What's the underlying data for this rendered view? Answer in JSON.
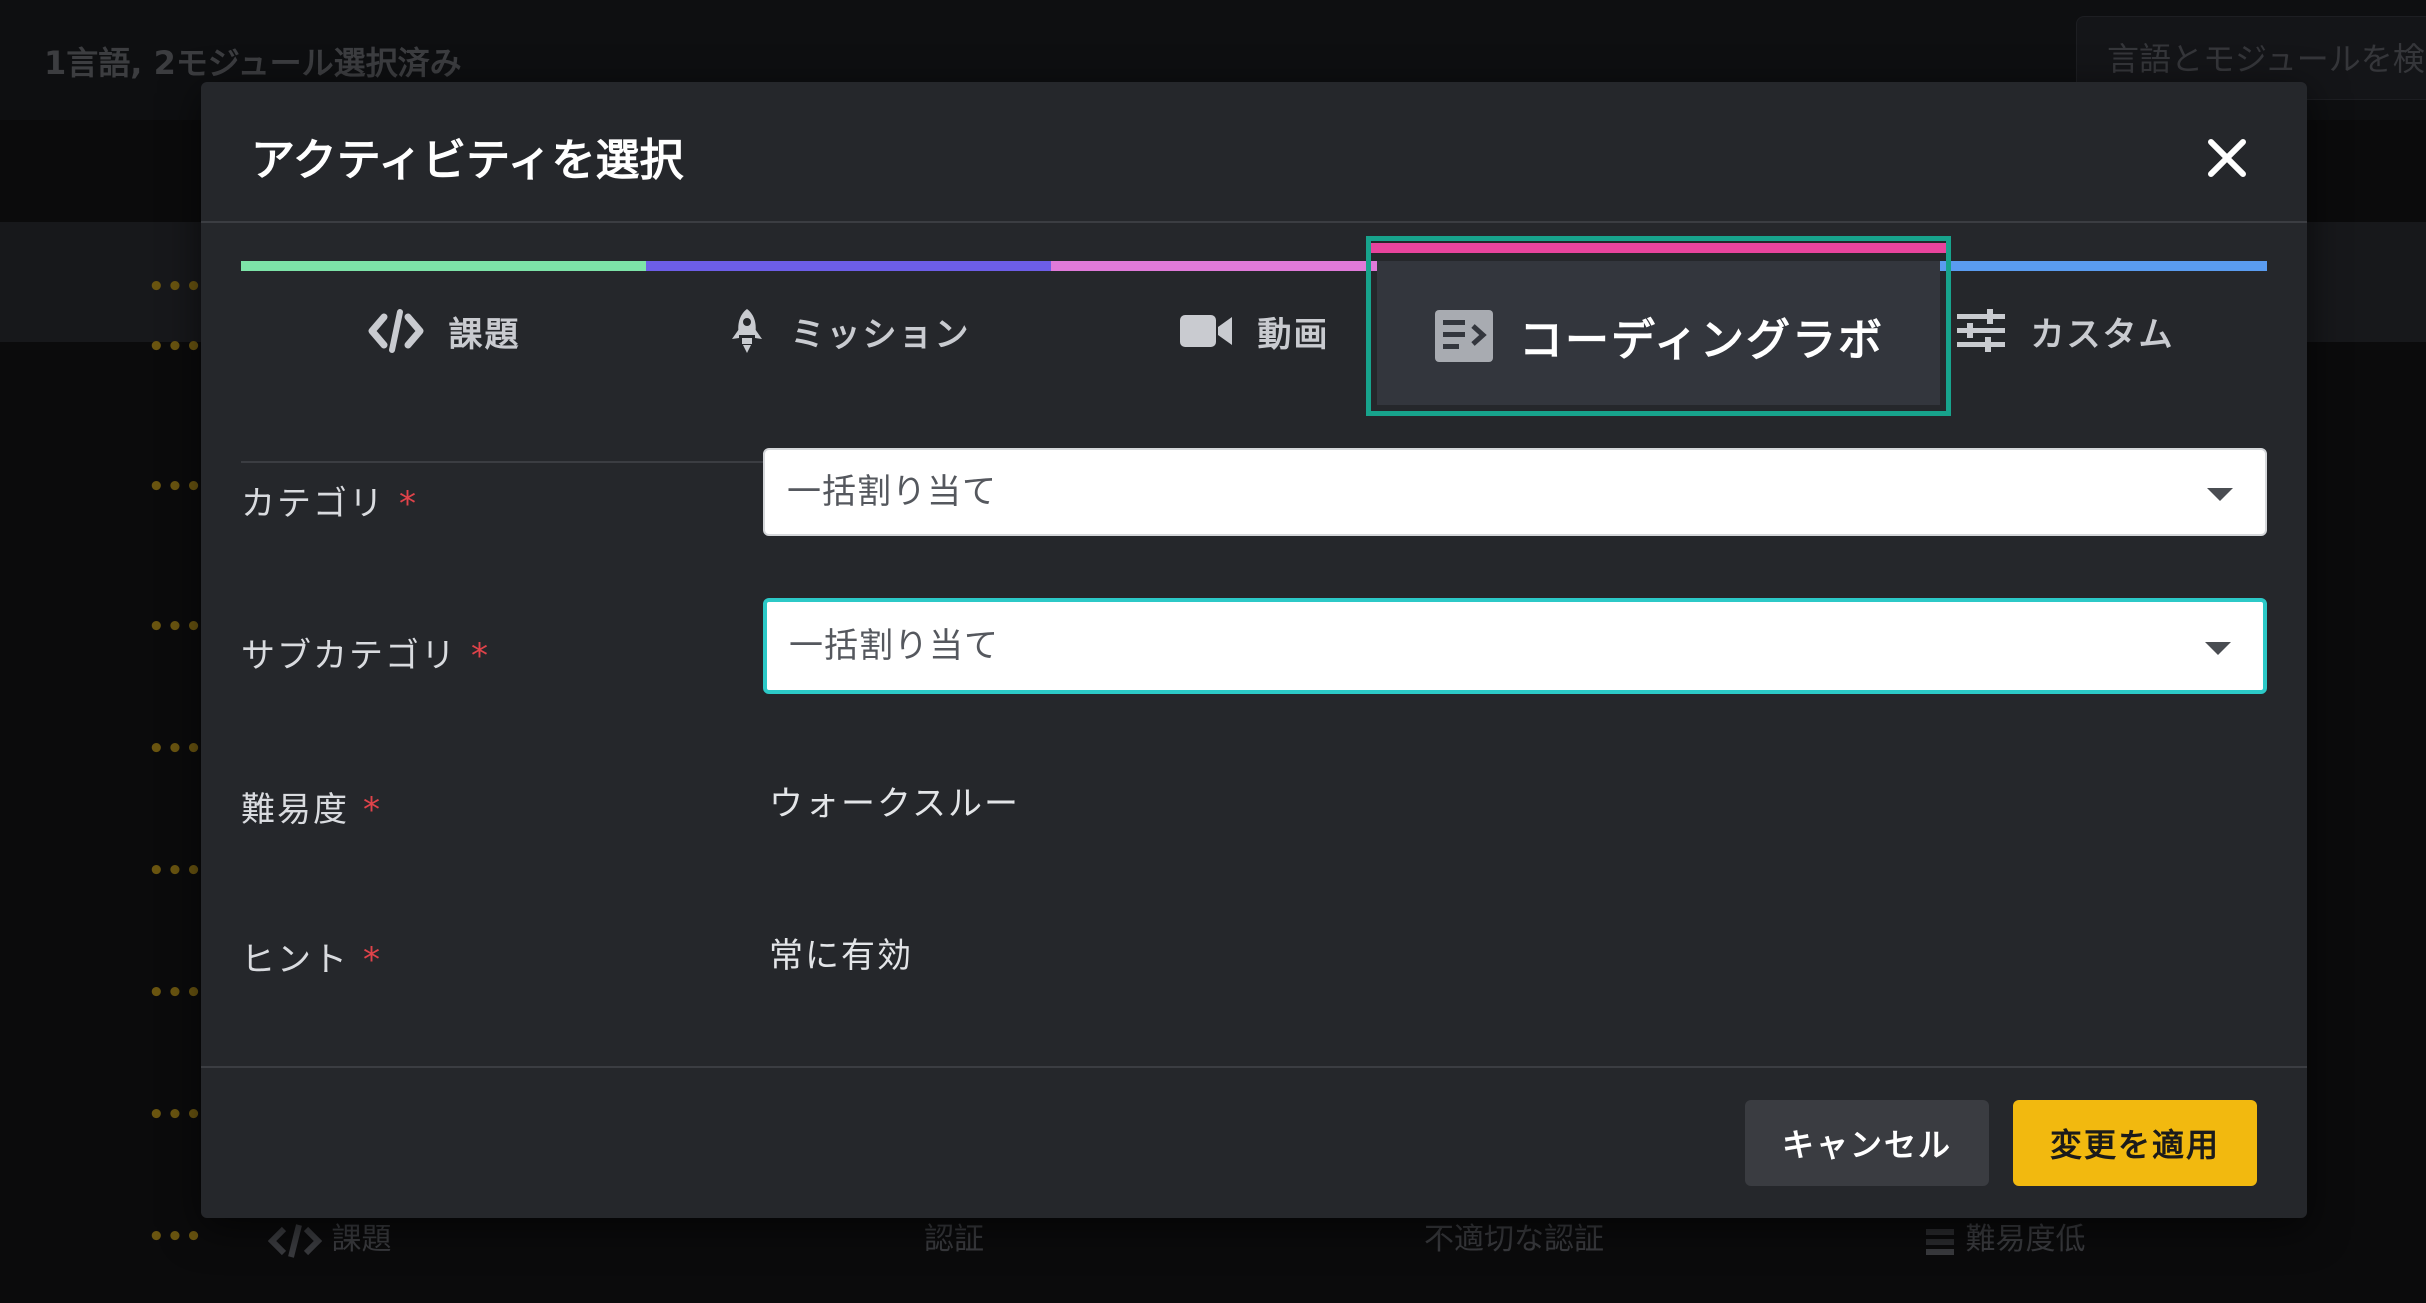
{
  "background": {
    "summary": "1言語, 2モジュール選択済み",
    "search_placeholder": "言語とモジュールを検",
    "row": {
      "type": "課題",
      "category": "認証",
      "subcategory": "不適切な認証",
      "difficulty": "難易度低"
    },
    "dots": "•••"
  },
  "modal": {
    "title": "アクティビティを選択",
    "close_icon": "close-icon",
    "tabs": [
      {
        "label": "課題",
        "icon": "code-icon",
        "color": "#7de3a8"
      },
      {
        "label": "ミッション",
        "icon": "rocket-icon",
        "color": "#6d5ee8"
      },
      {
        "label": "動画",
        "icon": "video-camera-icon",
        "color": "#e07ad9"
      },
      {
        "label": "コーディングラボ",
        "icon": "coding-lab-icon",
        "color": "#e8449d",
        "active": true
      },
      {
        "label": "カスタム",
        "icon": "sliders-icon",
        "color": "#5a9cf0"
      }
    ],
    "fields": {
      "category": {
        "label": "カテゴリ",
        "value": "一括割り当て"
      },
      "subcategory": {
        "label": "サブカテゴリ",
        "value": "一括割り当て"
      },
      "difficulty": {
        "label": "難易度",
        "value": "ウォークスルー"
      },
      "hints": {
        "label": "ヒント",
        "value": "常に有効"
      }
    },
    "required_mark": "*",
    "buttons": {
      "cancel": "キャンセル",
      "apply": "変更を適用"
    }
  },
  "colors": {
    "accent": "#f2b90f",
    "active_tab_outline": "#17a38c",
    "focus": "#2cc9c7",
    "required": "#e0434a"
  }
}
